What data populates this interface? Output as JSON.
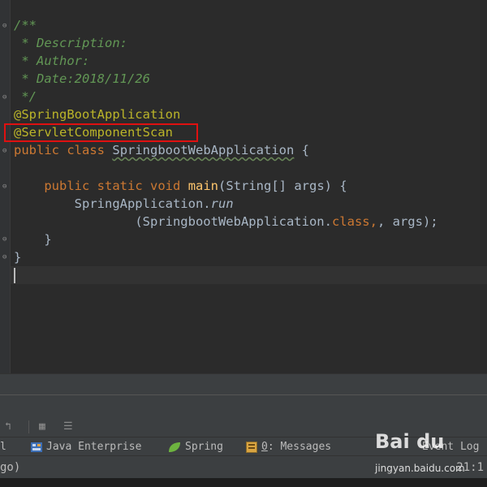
{
  "code": {
    "comment_open": "/**",
    "comment_description": " * Description:",
    "comment_author": " * Author:",
    "comment_date": " * Date:2018/11/26",
    "comment_close": " */",
    "annotation_1": "@SpringBootApplication",
    "annotation_2": "@ServletComponentScan",
    "kw_public": "public",
    "kw_class": "class",
    "class_name": "SpringbootWebApplication",
    "brace_open": " {",
    "kw_static": "static",
    "kw_void": "void",
    "method_name": "main",
    "params": "(String[] args) {",
    "call_target": "SpringApplication.",
    "call_method": "run",
    "call_args_open": "(SpringbootWebApplication.",
    "kw_class_literal": "class",
    "call_args_rest": ", args);",
    "close_method": "}",
    "close_class": "}"
  },
  "tool_tabs": {
    "left_partial": "l",
    "java_enterprise": "Java Enterprise",
    "spring": "Spring",
    "messages_num": "0",
    "messages": ": Messages",
    "event_log": "Event Log"
  },
  "status_bar": {
    "left_text": "go)",
    "position": "21:1"
  },
  "watermark": {
    "brand": "Bai du",
    "site": "jingyan.baidu.com"
  },
  "colors": {
    "background": "#2b2b2b",
    "comment": "#629755",
    "annotation": "#bbb529",
    "keyword": "#cc7832",
    "method": "#ffc66d",
    "highlight_box": "#e01010"
  }
}
